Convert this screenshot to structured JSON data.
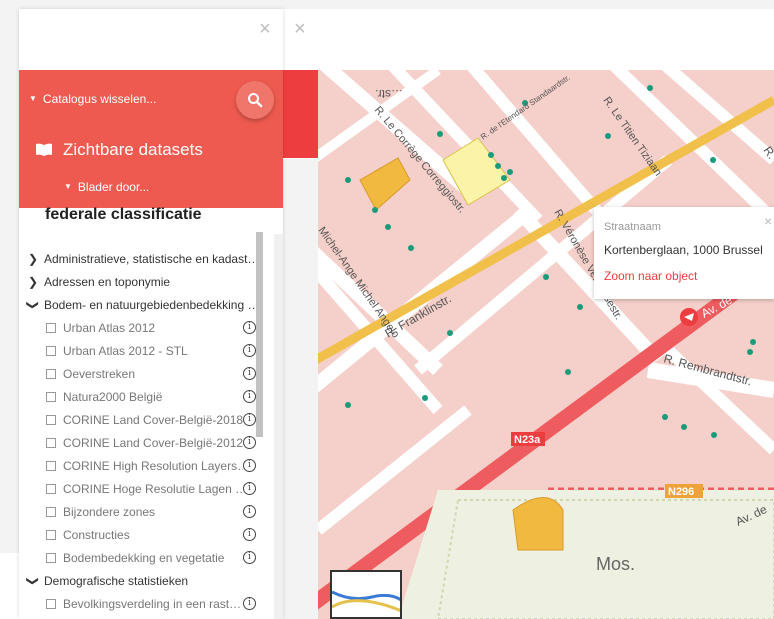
{
  "panel": {
    "close_glyph": "×",
    "catalog_switch": "Catalogus wisselen...",
    "datasets_title": "Zichtbare datasets",
    "browse": "Blader door...",
    "classification": "federale classificatie",
    "categories": [
      {
        "label": "Administratieve, statistische en kadast…",
        "expanded": false
      },
      {
        "label": "Adressen en toponymie",
        "expanded": false
      },
      {
        "label": "Bodem- en natuurgebiedenbedekking …",
        "expanded": true
      }
    ],
    "items": [
      "Urban Atlas 2012",
      "Urban Atlas 2012 - STL",
      "Oeverstreken",
      "Natura2000 België",
      "CORINE Land Cover-België-2018",
      "CORINE Land Cover-België-2012",
      "CORINE High Resolution Layers…",
      "CORINE Hoge Resolutie Lagen …",
      "Bijzondere zones",
      "Constructies",
      "Bodembedekking en vegetatie"
    ],
    "category_demo": "Demografische statistieken",
    "item_partial": "Bevolkingsverdeling in een rast…",
    "info_glyph": "i"
  },
  "popup": {
    "label": "Straatnaam",
    "value": "Kortenberglaan, 1000 Brussel",
    "link": "Zoom naar object",
    "close_glyph": "×"
  },
  "map": {
    "labels": {
      "corregio": "R. Le Corrège Correggiostr.",
      "etendard": "R. de l'Etendard Standaardstr.",
      "titien": "R. Le Titien Tiziaan",
      "michel": "Michel-Ange Michel Angelo",
      "franklin": "R. Franklinstr.",
      "veronese": "R. Véronèse Veronesestr.",
      "rembrandt": "R. Rembrandtstr.",
      "avde": "Av. de",
      "avdel": "Av. de",
      "mos": "Mos.",
      "top_street": "…str.",
      "small_r": "R.",
      "right_r": "R."
    },
    "road_badges": [
      "N23a",
      "N296"
    ]
  },
  "colors": {
    "accent": "#ee5a4f",
    "accent_dark": "#ee3d3e",
    "major_road": "#ee5c5f",
    "secondary_road": "#f0c04a",
    "block": "#f5cfc9",
    "street": "#ffffff",
    "tree_dot": "#1a9b7a",
    "feature_orange": "#f1b93f",
    "feature_yellow": "#faf3a8"
  }
}
